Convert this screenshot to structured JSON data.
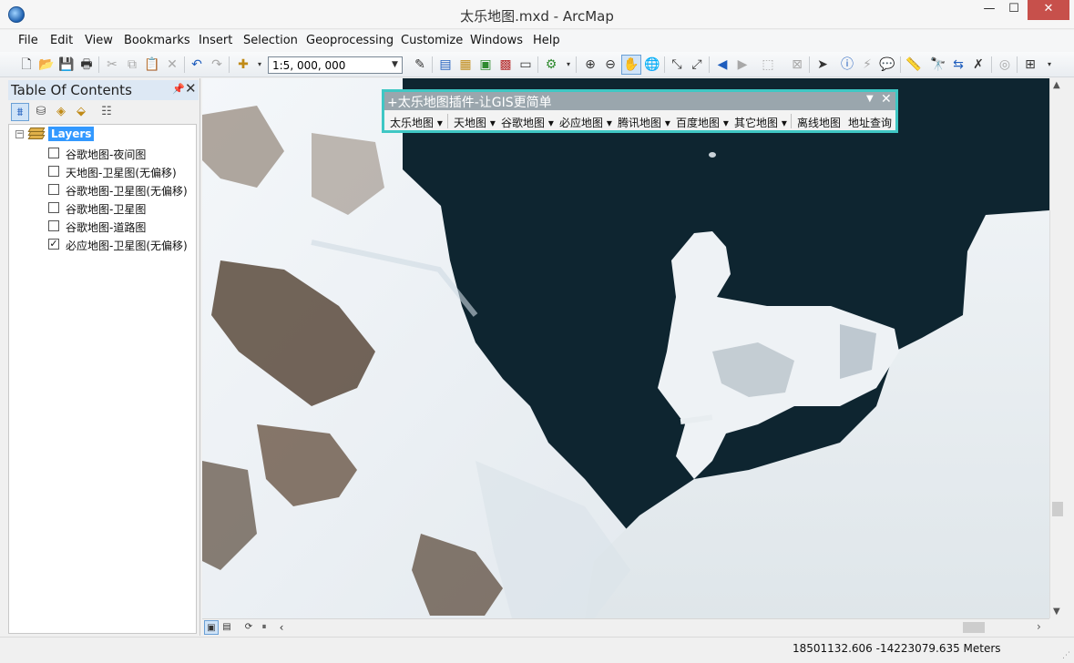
{
  "window": {
    "title": "太乐地图.mxd - ArcMap",
    "minimize": "—",
    "maximize": "☐",
    "close": "✕"
  },
  "menu": [
    "File",
    "Edit",
    "View",
    "Bookmarks",
    "Insert",
    "Selection",
    "Geoprocessing",
    "Customize",
    "Windows",
    "Help"
  ],
  "toolbar": {
    "scale": "1:5, 000, 000"
  },
  "toc": {
    "title": "Table Of Contents",
    "pin": "📌",
    "close": "✕",
    "root_label": "Layers",
    "expander": "−",
    "layers": [
      {
        "name": "谷歌地图-夜间图",
        "checked": false
      },
      {
        "name": "天地图-卫星图(无偏移)",
        "checked": false
      },
      {
        "name": "谷歌地图-卫星图(无偏移)",
        "checked": false
      },
      {
        "name": "谷歌地图-卫星图",
        "checked": false
      },
      {
        "name": "谷歌地图-道路图",
        "checked": false
      },
      {
        "name": "必应地图-卫星图(无偏移)",
        "checked": true
      }
    ]
  },
  "plugin": {
    "title": "+太乐地图插件-让GIS更简单",
    "buttons": [
      {
        "label": "太乐地图 ▾"
      },
      {
        "label": "天地图 ▾"
      },
      {
        "label": "谷歌地图 ▾"
      },
      {
        "label": "必应地图 ▾"
      },
      {
        "label": "腾讯地图 ▾"
      },
      {
        "label": "百度地图 ▾"
      },
      {
        "label": "其它地图 ▾"
      },
      {
        "label": "离线地图"
      },
      {
        "label": "地址查询"
      }
    ]
  },
  "status": {
    "coordinates": "18501132.606  -14223079.635 Meters"
  },
  "colors": {
    "accent": "#3fc7c4",
    "selection": "#3399ff",
    "close_red": "#c7504b",
    "water": "#0e2530"
  }
}
